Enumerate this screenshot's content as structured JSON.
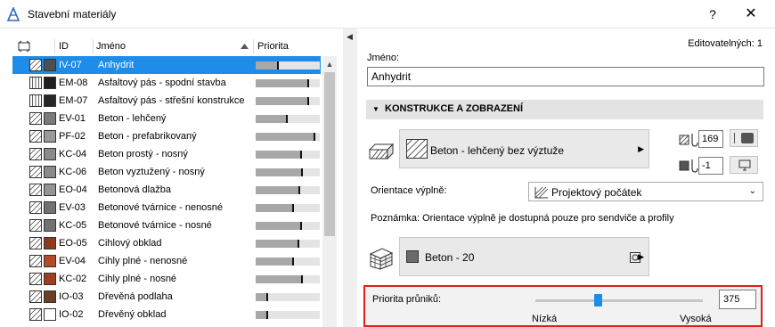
{
  "window": {
    "title": "Stavební materiály",
    "help_label": "?",
    "close_label": "✕"
  },
  "list": {
    "columns": {
      "id": "ID",
      "name": "Jméno",
      "priority": "Priorita"
    },
    "rows": [
      {
        "id": "IV-07",
        "name": "Anhydrit",
        "swatch": "#4f4f4f",
        "priority": 0.36,
        "selected": true
      },
      {
        "id": "EM-08",
        "name": "Asfaltový pás - spodní stavba",
        "swatch": "#1f1f1f",
        "priority": 0.84,
        "selected": false
      },
      {
        "id": "EM-07",
        "name": "Asfaltový pás - střešní konstrukce",
        "swatch": "#262626",
        "priority": 0.84,
        "selected": false
      },
      {
        "id": "EV-01",
        "name": "Beton - lehčený",
        "swatch": "#7b7b7b",
        "priority": 0.5,
        "selected": false
      },
      {
        "id": "PF-02",
        "name": "Beton - prefabrikovaný",
        "swatch": "#9a9a9a",
        "priority": 0.93,
        "selected": false
      },
      {
        "id": "KC-04",
        "name": "Beton prostý - nosný",
        "swatch": "#8a8a8a",
        "priority": 0.72,
        "selected": false
      },
      {
        "id": "KC-06",
        "name": "Beton vyztužený - nosný",
        "swatch": "#8a8a8a",
        "priority": 0.73,
        "selected": false
      },
      {
        "id": "EO-04",
        "name": "Betonová dlažba",
        "swatch": "#959595",
        "priority": 0.7,
        "selected": false
      },
      {
        "id": "EV-03",
        "name": "Betonové tvárnice - nenosné",
        "swatch": "#727272",
        "priority": 0.6,
        "selected": false
      },
      {
        "id": "KC-05",
        "name": "Betonové tvárnice - nosné",
        "swatch": "#727272",
        "priority": 0.72,
        "selected": false
      },
      {
        "id": "EO-05",
        "name": "Cihlový obklad",
        "swatch": "#8d3b1c",
        "priority": 0.68,
        "selected": false
      },
      {
        "id": "EV-04",
        "name": "Cihly plné - nenosné",
        "swatch": "#b54a29",
        "priority": 0.6,
        "selected": false
      },
      {
        "id": "KC-02",
        "name": "Cihly plné - nosné",
        "swatch": "#a13e1f",
        "priority": 0.73,
        "selected": false
      },
      {
        "id": "IO-03",
        "name": "Dřevěná podlaha",
        "swatch": "#6b3f22",
        "priority": 0.2,
        "selected": false
      },
      {
        "id": "IO-02",
        "name": "Dřevěný obklad",
        "swatch": "#ffffff",
        "priority": 0.2,
        "selected": false
      }
    ]
  },
  "details": {
    "editable_count": "Editovatelných: 1",
    "name_label": "Jméno:",
    "name_value": "Anhydrit",
    "section_title": "KONSTRUKCE A ZOBRAZENÍ",
    "cut_fill_label": "Beton - lehčený bez výztuže",
    "pen_fill": "169",
    "pen_background": "-1",
    "orientation_label": "Orientace výplně:",
    "orientation_value": "Projektový počátek",
    "note": "Poznámka: Orientace výplně je dostupná pouze pro sendviče a profily",
    "surface_label": "Beton - 20",
    "priority_label": "Priorita průniků:",
    "priority_value": "375",
    "priority_fraction": 0.37,
    "low_label": "Nízká",
    "high_label": "Vysoká",
    "accent_color": "#1e8de9",
    "highlight_color": "#e21d1d"
  }
}
